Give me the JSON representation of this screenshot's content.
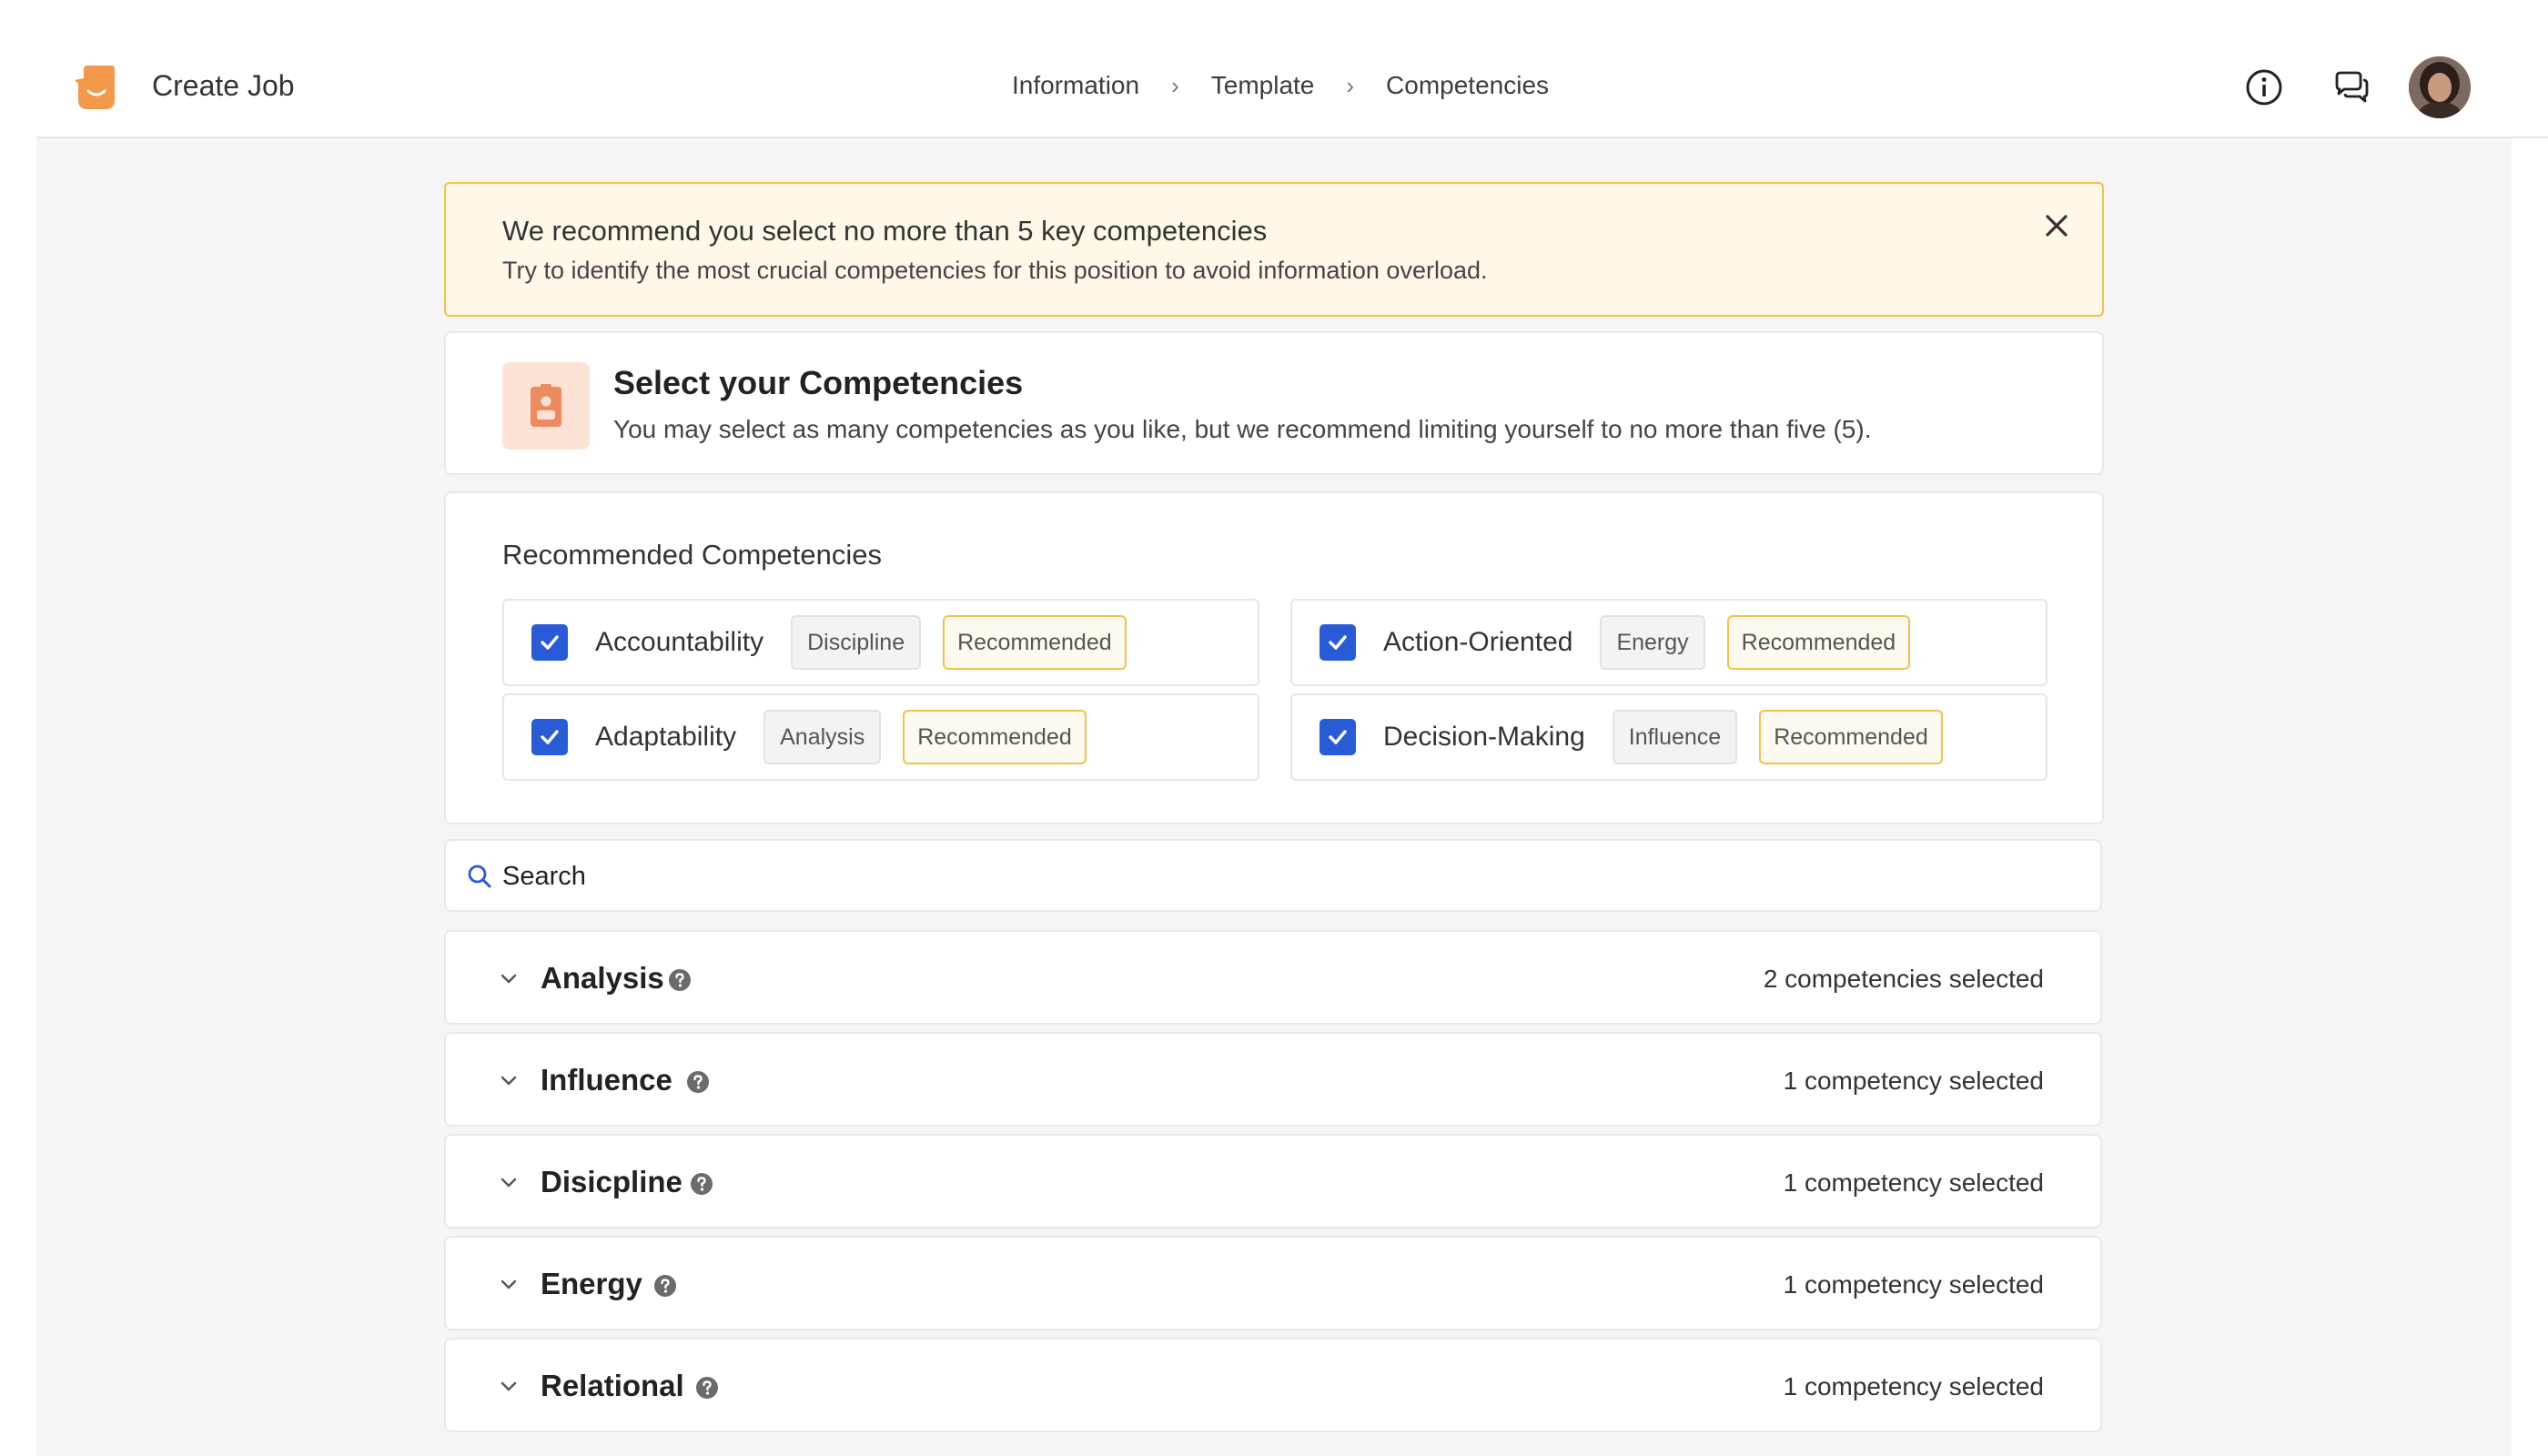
{
  "header": {
    "app_title": "Create Job",
    "breadcrumbs": [
      "Information",
      "Template",
      "Competencies"
    ],
    "breadcrumb_separator": "›"
  },
  "alert": {
    "title": "We recommend you select no more than 5 key competencies",
    "body": "Try to identify the most crucial competencies for this position to avoid information overload."
  },
  "select_card": {
    "title": "Select your Competencies",
    "subtitle": "You may select as many competencies as you like, but we recommend limiting yourself to no more than five (5)."
  },
  "recommended": {
    "title": "Recommended Competencies",
    "badge_label": "Recommended",
    "items": [
      {
        "name": "Accountability",
        "tag": "Discipline",
        "checked": true
      },
      {
        "name": "Action-Oriented",
        "tag": "Energy",
        "checked": true
      },
      {
        "name": "Adaptability",
        "tag": "Analysis",
        "checked": true
      },
      {
        "name": "Decision-Making",
        "tag": "Influence",
        "checked": true
      }
    ]
  },
  "search": {
    "placeholder": "Search"
  },
  "categories": [
    {
      "title": "Analysis",
      "count": "2 competencies selected"
    },
    {
      "title": "Influence",
      "count": "1 competency selected"
    },
    {
      "title": "Disicpline",
      "count": "1 competency selected"
    },
    {
      "title": "Energy",
      "count": "1 competency selected"
    },
    {
      "title": "Relational",
      "count": "1 competency selected"
    }
  ],
  "colors": {
    "accent_blue": "#2a5bd7",
    "brand_orange": "#f2994a",
    "alert_border": "#f2c24a",
    "alert_bg": "#fff8e8"
  },
  "icons": {
    "logo": "smile-badge-icon",
    "info": "info-circle-icon",
    "chat": "chat-bubbles-icon",
    "close": "close-icon",
    "competency": "id-badge-icon",
    "search": "search-icon",
    "chevron": "chevron-down-icon",
    "help": "help-circle-icon"
  }
}
